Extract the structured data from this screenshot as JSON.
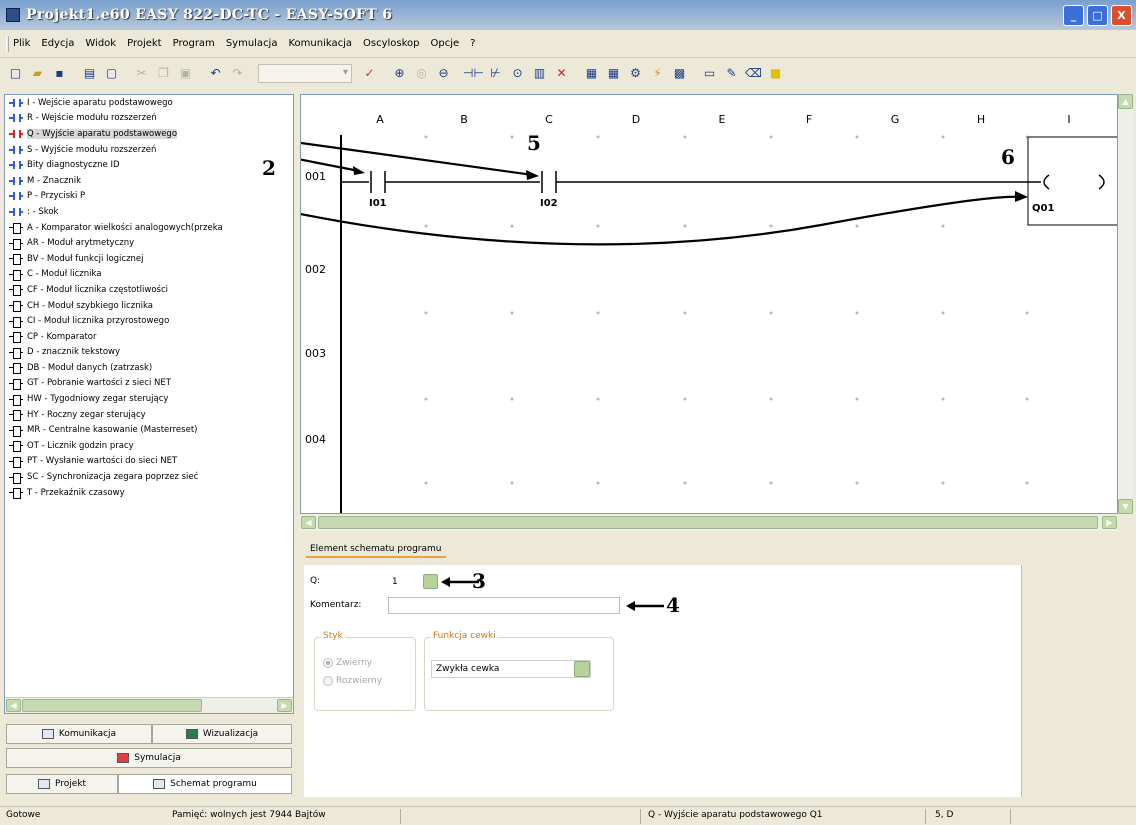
{
  "window": {
    "title": "Projekt1.e60 EASY 822-DC-TC - EASY-SOFT 6",
    "controls": [
      "_",
      "□",
      "X"
    ]
  },
  "menu": [
    "Plik",
    "Edycja",
    "Widok",
    "Projekt",
    "Program",
    "Symulacja",
    "Komunikacja",
    "Oscyloskop",
    "Opcje",
    "?"
  ],
  "tree": {
    "items": [
      {
        "label": "I - Wejście aparatu podstawowego",
        "icon": "contact-icon"
      },
      {
        "label": "R - Wejście modułu rozszerzeń",
        "icon": "contact-icon"
      },
      {
        "label": "Q - Wyjście aparatu podstawowego",
        "icon": "contact-icon-red"
      },
      {
        "label": "S - Wyjście modułu rozszerzeń",
        "icon": "contact-icon"
      },
      {
        "label": "Bity diagnostyczne ID",
        "icon": "contact-icon"
      },
      {
        "label": "M - Znacznik",
        "icon": "contact-icon"
      },
      {
        "label": "P - Przyciski P",
        "icon": "contact-icon"
      },
      {
        "label": ": - Skok",
        "icon": "contact-icon"
      },
      {
        "label": "A - Komparator wielkości analogowych(przeka",
        "icon": "module-icon"
      },
      {
        "label": "AR - Moduł arytmetyczny",
        "icon": "module-icon"
      },
      {
        "label": "BV - Moduł funkcji logicznej",
        "icon": "module-icon"
      },
      {
        "label": "C - Moduł licznika",
        "icon": "module-icon"
      },
      {
        "label": "CF - Moduł licznika częstotliwości",
        "icon": "module-icon"
      },
      {
        "label": "CH - Moduł szybkiego licznika",
        "icon": "module-icon"
      },
      {
        "label": "CI - Moduł licznika przyrostowego",
        "icon": "module-icon"
      },
      {
        "label": "CP - Komparator",
        "icon": "module-icon"
      },
      {
        "label": "D - znacznik tekstowy",
        "icon": "module-icon"
      },
      {
        "label": "DB - Moduł danych (zatrzask)",
        "icon": "module-icon"
      },
      {
        "label": "GT - Pobranie wartości z sieci NET",
        "icon": "module-icon"
      },
      {
        "label": "HW - Tygodniowy zegar sterujący",
        "icon": "module-icon"
      },
      {
        "label": "HY - Roczny zegar sterujący",
        "icon": "module-icon"
      },
      {
        "label": "MR - Centralne kasowanie (Masterreset)",
        "icon": "module-icon"
      },
      {
        "label": "OT - Licznik godzin pracy",
        "icon": "module-icon"
      },
      {
        "label": "PT - Wysłanie wartości do sieci NET",
        "icon": "module-icon"
      },
      {
        "label": "SC - Synchronizacja zegara poprzez sieć",
        "icon": "module-icon"
      },
      {
        "label": "T - Przekaźnik czasowy",
        "icon": "module-icon"
      }
    ]
  },
  "left_tabs": {
    "komunikacja": "Komunikacja",
    "wizualizacja": "Wizualizacja",
    "symulacja": "Symulacja",
    "projekt": "Projekt",
    "schemat": "Schemat programu"
  },
  "ladder": {
    "columns": [
      "A",
      "B",
      "C",
      "D",
      "E",
      "F",
      "G",
      "H",
      "I"
    ],
    "rows": [
      "001",
      "002",
      "003",
      "004"
    ],
    "contacts": [
      {
        "label": "I01"
      },
      {
        "label": "I02"
      }
    ],
    "coil": {
      "label": "Q01"
    }
  },
  "annotations": [
    "2",
    "5",
    "6",
    "3",
    "4"
  ],
  "properties": {
    "tab": "Element schematu programu",
    "q_label": "Q:",
    "q_value": "1",
    "comment_label": "Komentarz:",
    "comment_value": "",
    "styk_legend": "Styk",
    "radio_no": "Zwierny",
    "radio_nc": "Rozwierny",
    "coil_legend": "Funkcja cewki",
    "coil_value": "Zwykła cewka"
  },
  "status": {
    "ready": "Gotowe",
    "memory": "Pamięć: wolnych jest 7944 Bajtów",
    "selection": "Q - Wyjście aparatu podstawowego Q1",
    "position": "5, D"
  }
}
